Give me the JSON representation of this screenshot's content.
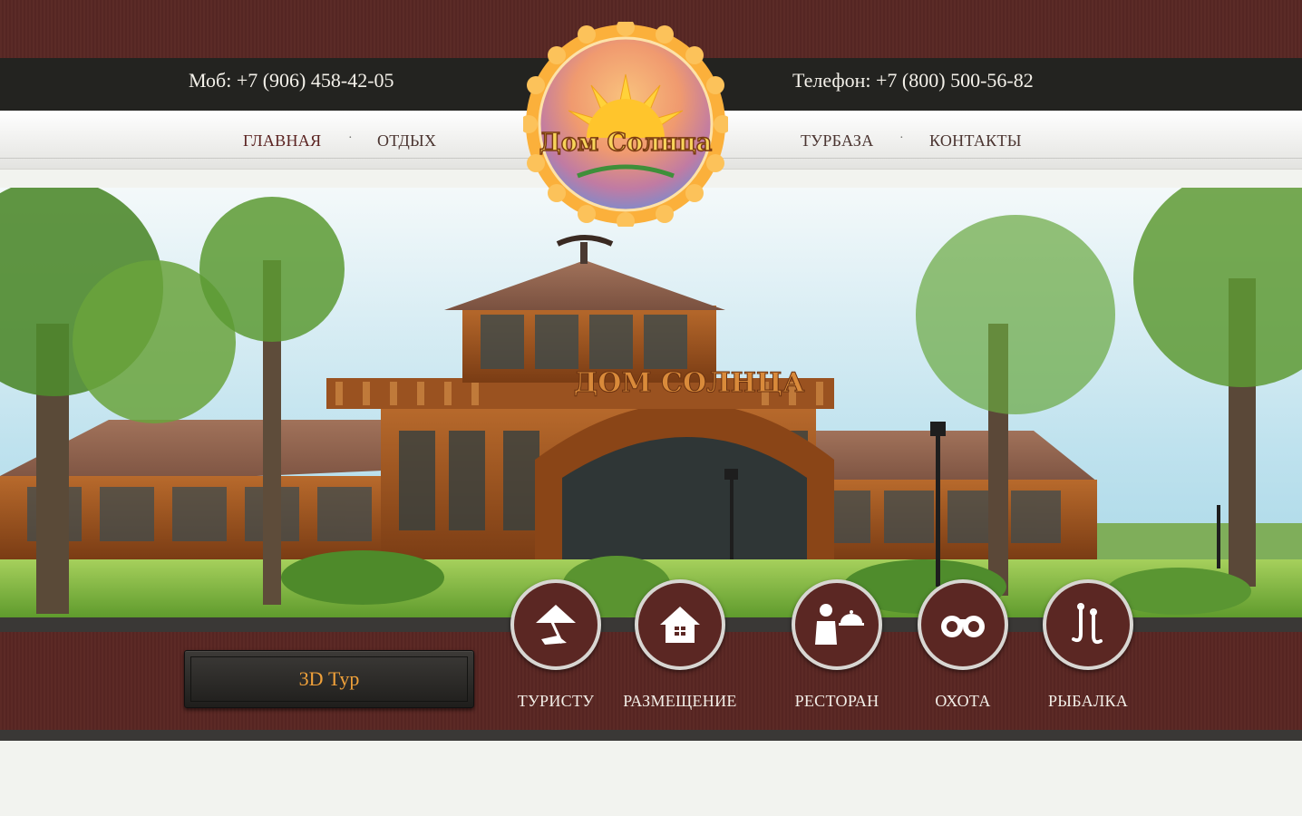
{
  "header": {
    "mobile_phone": "Моб: +7 (906) 458-42-05",
    "phone": "Телефон: +7 (800) 500-56-82"
  },
  "logo": {
    "text": "Дом Солнца"
  },
  "nav": {
    "items": [
      {
        "label": "ГЛАВНАЯ"
      },
      {
        "label": "ОТДЫХ"
      },
      {
        "label": "ТУРБАЗА"
      },
      {
        "label": "КОНТАКТЫ"
      }
    ],
    "separator": "·"
  },
  "hero": {
    "sign_text": "ДОМ СОЛНЦА"
  },
  "panel": {
    "tour_button": "3D Тур",
    "categories": [
      {
        "label": "ТУРИСТУ",
        "icon": "beach-umbrella-icon"
      },
      {
        "label": "РАЗМЕЩЕНИЕ",
        "icon": "house-icon"
      },
      {
        "label": "РЕСТОРАН",
        "icon": "waiter-icon"
      },
      {
        "label": "ОХОТА",
        "icon": "binoculars-icon"
      },
      {
        "label": "РЫБАЛКА",
        "icon": "fishing-hooks-icon"
      }
    ]
  },
  "colors": {
    "maroon": "#5b2b27",
    "dark_bar": "#232320",
    "accent_orange": "#f0a13a",
    "nav_text": "#4a3430"
  }
}
